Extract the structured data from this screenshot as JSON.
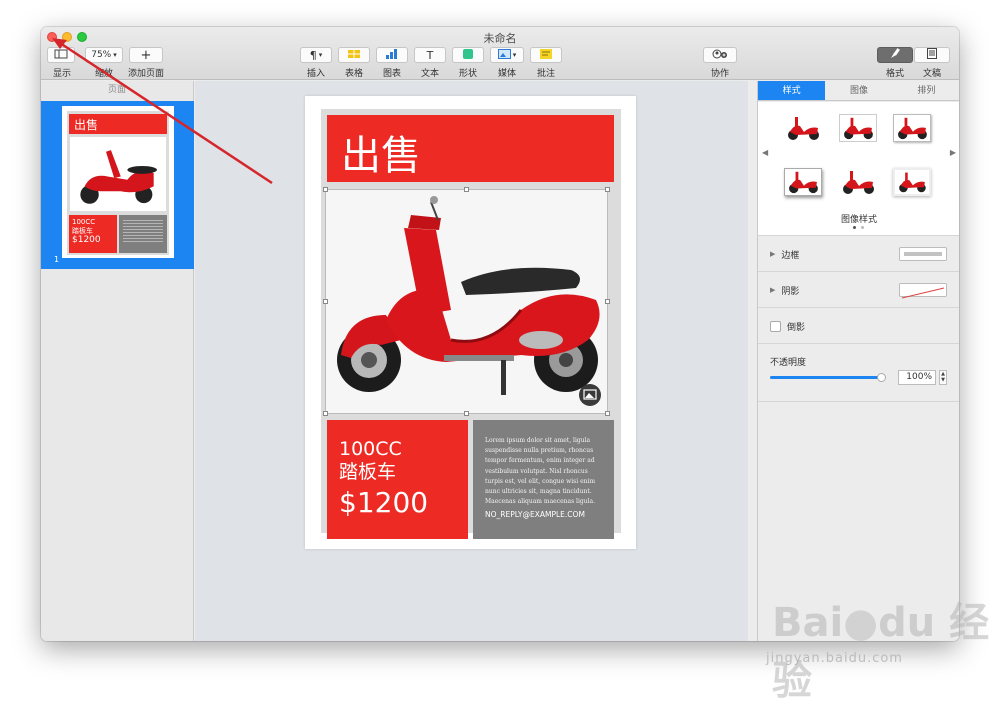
{
  "window": {
    "title": "未命名"
  },
  "toolbar": {
    "view_label": "显示",
    "zoom_value": "75%",
    "zoom_label": "缩放",
    "add_page_label": "添加页面",
    "insert_label": "插入",
    "table_label": "表格",
    "chart_label": "图表",
    "text_label": "文本",
    "shape_label": "形状",
    "media_label": "媒体",
    "comment_label": "批注",
    "collaborate_label": "协作",
    "format_label": "格式",
    "document_label": "文稿"
  },
  "sidebar_left": {
    "header": "页面",
    "thumbnails": [
      {
        "number": "1",
        "title": "出售",
        "line1": "100CC",
        "line2": "踏板车",
        "price": "$1200"
      }
    ]
  },
  "document": {
    "heading": "出售",
    "product_size": "100CC",
    "product_type": "踏板车",
    "price": "$1200",
    "body": "Lorem ipsum dolor sit amet, ligula suspendisse nulla pretium, rhoncus tempor fermentum, enim integer ad vestibulum volutpat. Nisl rhoncus turpis est, vel elit, congue wisi enim nunc ultricies sit, magna tincidunt. Maecenas aliquam maecenas ligula.",
    "email": "NO_REPLY@EXAMPLE.COM"
  },
  "inspector": {
    "tabs": [
      "样式",
      "图像",
      "排列"
    ],
    "active_tab": "样式",
    "image_styles_label": "图像样式",
    "border_label": "边框",
    "shadow_label": "阴影",
    "reflection_label": "倒影",
    "opacity_label": "不透明度",
    "opacity_value": "100%",
    "opacity_level": 1.0
  },
  "colors": {
    "accent_red": "#ed2a24",
    "selection_blue": "#1d85f2",
    "grey_box": "#7f7f7f"
  }
}
